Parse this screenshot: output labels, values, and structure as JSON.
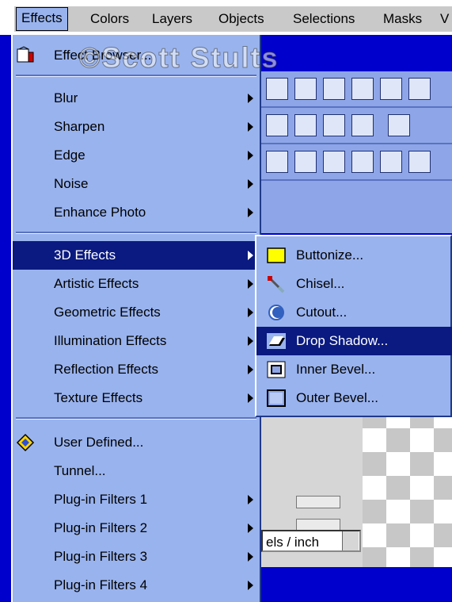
{
  "menubar": {
    "items": [
      "Effects",
      "Colors",
      "Layers",
      "Objects",
      "Selections",
      "Masks",
      "V"
    ],
    "active": "Effects"
  },
  "watermark": "©Scott Stults",
  "effects_menu": {
    "effect_browser": "Effect Browser...",
    "group1": [
      "Blur",
      "Sharpen",
      "Edge",
      "Noise",
      "Enhance Photo"
    ],
    "group2": [
      "3D Effects",
      "Artistic Effects",
      "Geometric Effects",
      "Illumination Effects",
      "Reflection Effects",
      "Texture Effects"
    ],
    "group3": [
      "User Defined...",
      "Tunnel...",
      "Plug-in Filters 1",
      "Plug-in Filters 2",
      "Plug-in Filters 3",
      "Plug-in Filters 4"
    ]
  },
  "submenu_3d": {
    "items": [
      "Buttonize...",
      "Chisel...",
      "Cutout...",
      "Drop Shadow...",
      "Inner Bevel...",
      "Outer Bevel..."
    ],
    "highlighted": "Drop Shadow..."
  },
  "background": {
    "unit_field": "els / inch"
  },
  "colors": {
    "menu_bg": "#99b3ee",
    "highlight": "#0a1a80",
    "desktop": "#0000cc"
  }
}
